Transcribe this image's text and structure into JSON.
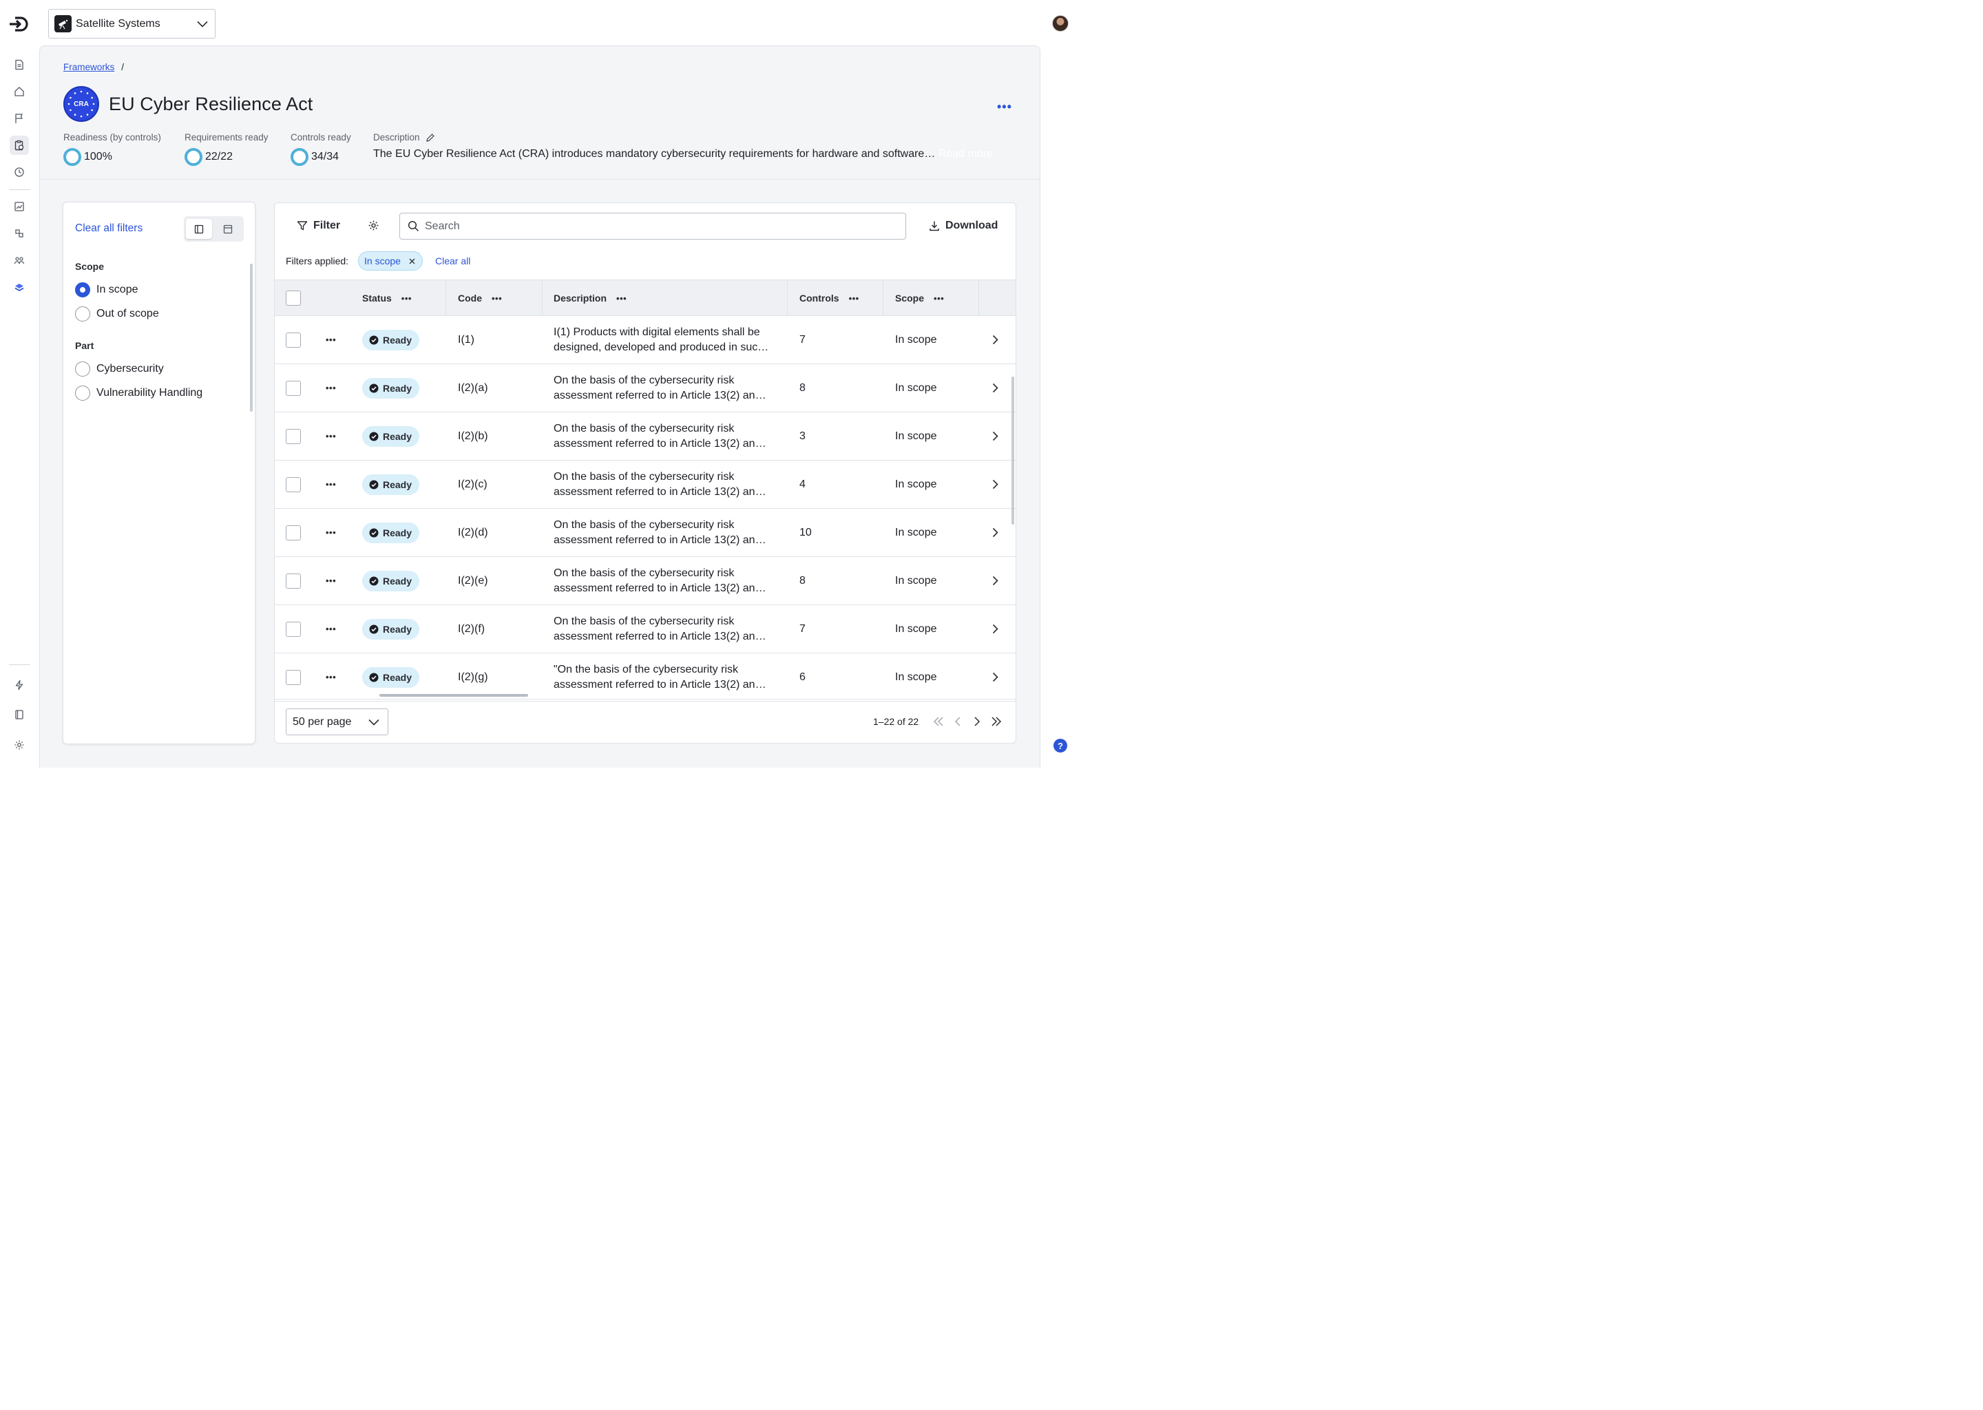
{
  "org": {
    "name": "Satellite Systems"
  },
  "breadcrumb": {
    "items": [
      "Frameworks"
    ],
    "separator": "/"
  },
  "framework": {
    "badge": "CRA",
    "title": "EU Cyber Resilience Act",
    "more_label": "•••"
  },
  "stats": {
    "readiness": {
      "label": "Readiness (by controls)",
      "value": "100%"
    },
    "requirements": {
      "label": "Requirements ready",
      "value": "22/22"
    },
    "controls": {
      "label": "Controls ready",
      "value": "34/34"
    },
    "description": {
      "label": "Description",
      "value": "The EU Cyber Resilience Act (CRA) introduces mandatory cybersecurity requirements for hardware and software…",
      "read_more": "Read more"
    }
  },
  "filters": {
    "clear_all": "Clear all filters",
    "scope": {
      "title": "Scope",
      "options": [
        {
          "label": "In scope",
          "checked": true
        },
        {
          "label": "Out of scope",
          "checked": false
        }
      ]
    },
    "part": {
      "title": "Part",
      "options": [
        {
          "label": "Cybersecurity",
          "checked": false
        },
        {
          "label": "Vulnerability Handling",
          "checked": false
        }
      ]
    }
  },
  "toolbar": {
    "filter_label": "Filter",
    "search_placeholder": "Search",
    "download_label": "Download",
    "applied_label": "Filters applied:",
    "chip_label": "In scope",
    "clear_all": "Clear all"
  },
  "table": {
    "columns": [
      "Status",
      "Code",
      "Description",
      "Controls",
      "Scope"
    ],
    "rows": [
      {
        "status": "Ready",
        "code": "I(1)",
        "description_1": "I(1) Products with digital elements shall be",
        "description_2": "designed, developed and produced in suc…",
        "controls": "7",
        "scope": "In scope"
      },
      {
        "status": "Ready",
        "code": "I(2)(a)",
        "description_1": "On the basis of the cybersecurity risk",
        "description_2": "assessment referred to in Article 13(2) an…",
        "controls": "8",
        "scope": "In scope"
      },
      {
        "status": "Ready",
        "code": "I(2)(b)",
        "description_1": "On the basis of the cybersecurity risk",
        "description_2": "assessment referred to in Article 13(2) an…",
        "controls": "3",
        "scope": "In scope"
      },
      {
        "status": "Ready",
        "code": "I(2)(c)",
        "description_1": "On the basis of the cybersecurity risk",
        "description_2": "assessment referred to in Article 13(2) an…",
        "controls": "4",
        "scope": "In scope"
      },
      {
        "status": "Ready",
        "code": "I(2)(d)",
        "description_1": "On the basis of the cybersecurity risk",
        "description_2": "assessment referred to in Article 13(2) an…",
        "controls": "10",
        "scope": "In scope"
      },
      {
        "status": "Ready",
        "code": "I(2)(e)",
        "description_1": "On the basis of the cybersecurity risk",
        "description_2": "assessment referred to in Article 13(2) an…",
        "controls": "8",
        "scope": "In scope"
      },
      {
        "status": "Ready",
        "code": "I(2)(f)",
        "description_1": "On the basis of the cybersecurity risk",
        "description_2": "assessment referred to in Article 13(2) an…",
        "controls": "7",
        "scope": "In scope"
      },
      {
        "status": "Ready",
        "code": "I(2)(g)",
        "description_1": "\"On the basis of the cybersecurity risk",
        "description_2": "assessment referred to in Article 13(2) an…",
        "controls": "6",
        "scope": "In scope"
      }
    ]
  },
  "pagination": {
    "per_page": "50 per page",
    "count": "1–22 of 22"
  },
  "help": {
    "label": "?"
  },
  "colors": {
    "accent": "#2c55d8",
    "ready_chip": "#d9effa",
    "ring": "#4fb0d9"
  }
}
